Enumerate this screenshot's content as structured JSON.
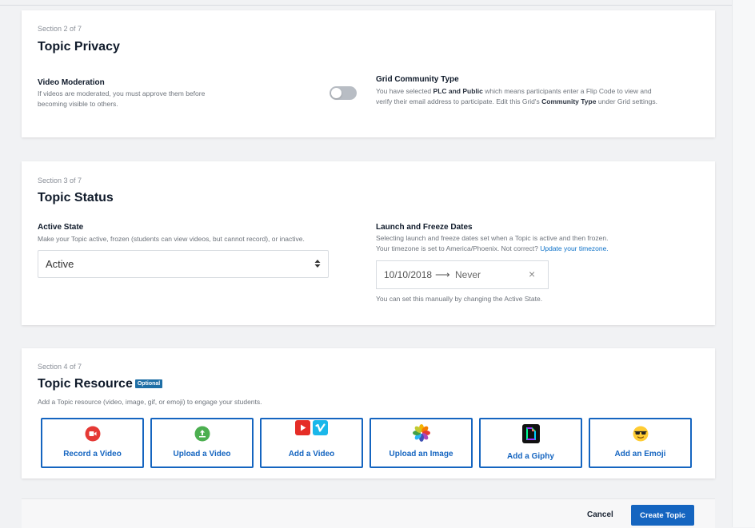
{
  "privacy": {
    "section_label": "Section 2 of 7",
    "title": "Topic Privacy",
    "moderation": {
      "title": "Video Moderation",
      "help_line1": "If videos are moderated, you must approve them before",
      "help_line2": "becoming visible to others.",
      "enabled": false
    },
    "community": {
      "title": "Grid Community Type",
      "line1_pre": "You have selected ",
      "line1_bold": "PLC and Public",
      "line1_post": " which means participants enter a Flip Code to view and",
      "line2_pre": "verify their email address to participate. Edit this Grid's ",
      "line2_bold": "Community Type",
      "line2_post": " under Grid settings."
    }
  },
  "status": {
    "section_label": "Section 3 of 7",
    "title": "Topic Status",
    "active": {
      "title": "Active State",
      "help": "Make your Topic active, frozen (students can view videos, but cannot record), or inactive.",
      "value": "Active"
    },
    "dates": {
      "title": "Launch and Freeze Dates",
      "help_line1": "Selecting launch and freeze dates set when a Topic is active and then frozen.",
      "help_line2_pre": "Your timezone is set to America/Phoenix. Not correct? ",
      "help_line2_link": "Update your timezone.",
      "launch": "10/10/2018",
      "arrow": "⟶",
      "freeze": "Never",
      "clear": "×",
      "note": "You can set this manually by changing the Active State."
    }
  },
  "resource": {
    "section_label": "Section 4 of 7",
    "title": "Topic Resource",
    "badge": "Optional",
    "help": "Add a Topic resource (video, image, gif, or emoji) to engage your students.",
    "buttons": [
      {
        "label": "Record a Video",
        "icon": "record-video-icon"
      },
      {
        "label": "Upload a Video",
        "icon": "upload-video-icon"
      },
      {
        "label": "Add a Video",
        "icon": "youtube-vimeo-icon"
      },
      {
        "label": "Upload an Image",
        "icon": "photos-icon"
      },
      {
        "label": "Add a Giphy",
        "icon": "giphy-icon"
      },
      {
        "label": "Add an Emoji",
        "icon": "sunglasses-emoji-icon"
      }
    ]
  },
  "footer": {
    "cancel": "Cancel",
    "create": "Create Topic"
  },
  "colors": {
    "accent": "#1565c0",
    "link": "#0d71c8",
    "record_red": "#e53935",
    "upload_green": "#4caf50",
    "youtube_red": "#e52d27",
    "vimeo_blue": "#1ab7ea",
    "optional_badge": "#1f6fa6"
  }
}
